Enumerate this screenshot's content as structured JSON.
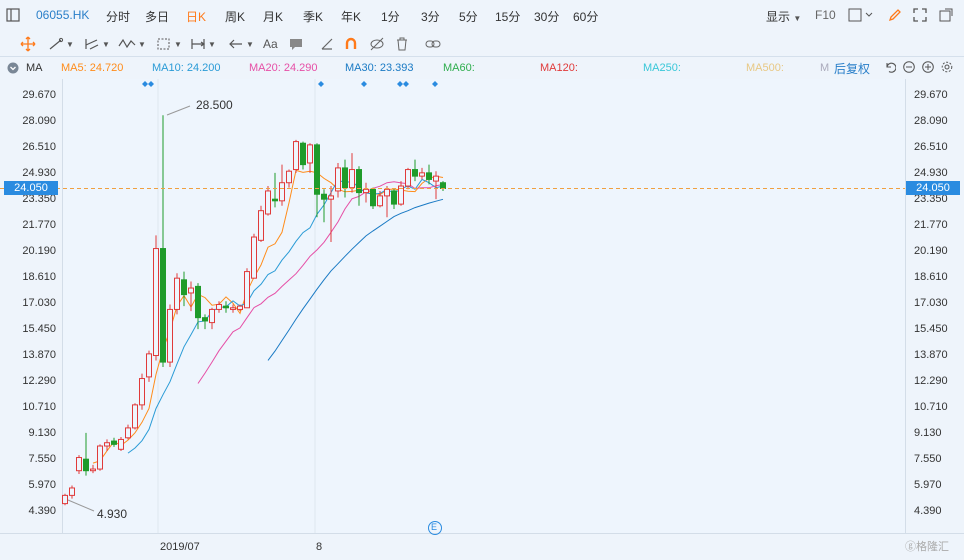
{
  "header": {
    "stock_code": "06055.HK",
    "tabs": [
      "分时",
      "多日",
      "日K",
      "周K",
      "月K",
      "季K",
      "年K",
      "1分",
      "3分",
      "5分",
      "15分",
      "30分",
      "60分"
    ],
    "active_tab": "日K",
    "display_label": "显示",
    "f10_label": "F10"
  },
  "toolbar": {
    "text_tool_label": "Aa"
  },
  "indicators": {
    "ma_label": "MA",
    "ma5": "MA5: 24.720",
    "ma10": "MA10: 24.200",
    "ma20": "MA20: 24.290",
    "ma30": "MA30: 23.393",
    "ma60": "MA60:",
    "ma120": "MA120:",
    "ma250": "MA250:",
    "ma500": "MA500:",
    "m_label": "M",
    "adjust_label": "后复权",
    "colors": {
      "ma5": "#ff8c1a",
      "ma10": "#2a9bd6",
      "ma20": "#e64fa6",
      "ma30": "#1a7ac4",
      "ma60": "#2fae4e",
      "ma120": "#e03a3a",
      "ma250": "#39c7d8",
      "ma500": "#e8c884"
    }
  },
  "chart_data": {
    "type": "candlestick",
    "y_ticks": [
      29.67,
      28.09,
      26.51,
      24.93,
      23.35,
      21.77,
      20.19,
      18.61,
      17.03,
      15.45,
      13.87,
      12.29,
      10.71,
      9.13,
      7.55,
      5.97,
      4.39
    ],
    "y_tick_labels": [
      "29.670",
      "28.090",
      "26.510",
      "24.930",
      "23.350",
      "21.770",
      "20.190",
      "18.610",
      "17.030",
      "15.450",
      "13.870",
      "12.290",
      "10.710",
      "9.130",
      "7.550",
      "5.970",
      "4.390"
    ],
    "current_price": "24.050",
    "high_annotation": "28.500",
    "low_annotation": "4.930",
    "x_labels": [
      "2019/07",
      "8"
    ],
    "event_marker": "E",
    "up_color": "#e03a3a",
    "down_color": "#1f9b2a",
    "candles": [
      [
        4.9,
        5.4,
        4.8,
        5.5
      ],
      [
        5.4,
        5.85,
        5.2,
        6.0
      ],
      [
        6.9,
        7.7,
        6.7,
        7.85
      ],
      [
        7.6,
        6.9,
        6.6,
        9.2
      ],
      [
        6.9,
        7.0,
        6.75,
        7.25
      ],
      [
        7.0,
        8.4,
        6.9,
        8.5
      ],
      [
        8.4,
        8.6,
        8.1,
        8.8
      ],
      [
        8.7,
        8.5,
        8.35,
        8.9
      ],
      [
        8.2,
        8.8,
        8.1,
        8.95
      ],
      [
        8.9,
        9.5,
        8.8,
        9.7
      ],
      [
        9.5,
        10.9,
        9.4,
        11.0
      ],
      [
        10.9,
        12.5,
        10.6,
        12.8
      ],
      [
        12.6,
        14.0,
        12.3,
        14.2
      ],
      [
        13.9,
        20.4,
        13.6,
        21.2
      ],
      [
        20.4,
        13.5,
        13.2,
        28.5
      ],
      [
        13.5,
        16.7,
        13.2,
        17.0
      ],
      [
        16.7,
        18.6,
        16.4,
        18.9
      ],
      [
        18.5,
        17.6,
        16.9,
        19.0
      ],
      [
        17.7,
        18.0,
        16.6,
        18.4
      ],
      [
        18.1,
        16.2,
        15.5,
        18.3
      ],
      [
        16.2,
        16.0,
        15.5,
        16.4
      ],
      [
        15.9,
        16.7,
        15.5,
        16.8
      ],
      [
        16.7,
        17.0,
        16.5,
        17.2
      ],
      [
        16.9,
        16.8,
        16.5,
        17.2
      ],
      [
        16.7,
        16.8,
        16.5,
        17.0
      ],
      [
        16.7,
        16.9,
        16.6,
        17.0
      ],
      [
        16.8,
        19.0,
        16.8,
        19.2
      ],
      [
        18.6,
        21.1,
        18.6,
        21.3
      ],
      [
        20.9,
        22.7,
        20.8,
        23.0
      ],
      [
        22.5,
        23.9,
        22.4,
        24.2
      ],
      [
        23.4,
        23.3,
        22.9,
        25.0
      ],
      [
        23.3,
        24.4,
        23.0,
        25.5
      ],
      [
        24.4,
        25.1,
        24.1,
        25.2
      ],
      [
        25.2,
        26.9,
        25.0,
        27.0
      ],
      [
        26.8,
        25.5,
        25.2,
        26.9
      ],
      [
        25.6,
        26.7,
        25.0,
        26.8
      ],
      [
        26.7,
        23.7,
        22.3,
        26.8
      ],
      [
        23.7,
        23.4,
        22.0,
        24.0
      ],
      [
        23.4,
        23.6,
        20.8,
        24.2
      ],
      [
        23.9,
        25.3,
        23.5,
        25.6
      ],
      [
        25.3,
        24.1,
        23.5,
        25.8
      ],
      [
        24.1,
        25.2,
        23.8,
        26.2
      ],
      [
        25.2,
        23.8,
        23.0,
        25.4
      ],
      [
        23.8,
        24.0,
        23.2,
        24.4
      ],
      [
        24.0,
        23.0,
        22.8,
        24.1
      ],
      [
        23.0,
        23.6,
        22.9,
        23.9
      ],
      [
        23.6,
        24.0,
        22.3,
        24.2
      ],
      [
        23.9,
        23.1,
        22.8,
        24.0
      ],
      [
        23.1,
        24.2,
        23.0,
        24.5
      ],
      [
        24.2,
        25.2,
        24.0,
        25.3
      ],
      [
        25.2,
        24.8,
        24.5,
        25.8
      ],
      [
        24.8,
        25.0,
        24.6,
        25.3
      ],
      [
        25.0,
        24.6,
        24.3,
        25.5
      ],
      [
        24.5,
        24.8,
        23.4,
        25.1
      ],
      [
        24.4,
        24.05,
        23.9,
        24.5
      ]
    ],
    "ma5_values": [
      null,
      null,
      null,
      null,
      7.36,
      7.5,
      8.11,
      8.66,
      8.44,
      8.76,
      9.2,
      9.84,
      10.68,
      12.75,
      14.29,
      15.42,
      16.9,
      17.54,
      16.84,
      17.62,
      17.42,
      16.96,
      17.02,
      17.46,
      17.08,
      16.46,
      17.78,
      18.66,
      19.4,
      20.48,
      20.69,
      21.39,
      23.18,
      25.15,
      25.03,
      25.1,
      25.01,
      24.66,
      24.4,
      24.0,
      23.85,
      23.87,
      23.94,
      23.94,
      23.77,
      23.67,
      23.98,
      24.02,
      23.96,
      23.88,
      23.86,
      24.36,
      24.66,
      24.79,
      24.72
    ],
    "ma10_values": [
      null,
      null,
      null,
      null,
      null,
      null,
      null,
      null,
      null,
      7.97,
      8.28,
      8.72,
      9.41,
      10.68,
      11.52,
      12.31,
      13.39,
      14.43,
      15.17,
      15.94,
      16.0,
      16.58,
      16.82,
      16.86,
      17.22,
      16.91,
      17.11,
      17.84,
      18.23,
      18.82,
      19.05,
      19.7,
      20.2,
      20.84,
      21.37,
      21.66,
      22.48,
      23.05,
      23.8,
      24.57,
      24.4,
      24.49,
      24.08,
      23.78,
      23.71,
      23.75,
      24.0,
      23.76,
      24.03,
      24.2,
      24.0,
      24.6,
      24.4,
      24.1,
      24.2
    ],
    "ma20_values": [
      null,
      null,
      null,
      null,
      null,
      null,
      null,
      null,
      null,
      null,
      null,
      null,
      null,
      null,
      null,
      null,
      null,
      null,
      null,
      12.2,
      12.83,
      13.5,
      14.19,
      14.77,
      15.34,
      15.58,
      16.2,
      16.81,
      17.04,
      17.44,
      17.68,
      18.1,
      18.49,
      18.87,
      19.38,
      19.93,
      20.32,
      20.78,
      21.39,
      22.02,
      22.81,
      23.42,
      23.57,
      23.85,
      24.06,
      24.19,
      24.4,
      24.46,
      24.39,
      24.34,
      24.05,
      24.1,
      24.09,
      24.22,
      24.29
    ],
    "ma30_values": [
      null,
      null,
      null,
      null,
      null,
      null,
      null,
      null,
      null,
      null,
      null,
      null,
      null,
      null,
      null,
      null,
      null,
      null,
      null,
      null,
      null,
      null,
      null,
      null,
      null,
      null,
      null,
      null,
      null,
      13.6,
      14.17,
      14.81,
      15.45,
      16.11,
      16.74,
      17.33,
      17.93,
      18.5,
      19.04,
      19.48,
      19.93,
      20.36,
      20.77,
      21.17,
      21.47,
      21.76,
      22.05,
      22.34,
      22.54,
      22.7,
      22.89,
      23.02,
      23.16,
      23.28,
      23.39
    ]
  }
}
